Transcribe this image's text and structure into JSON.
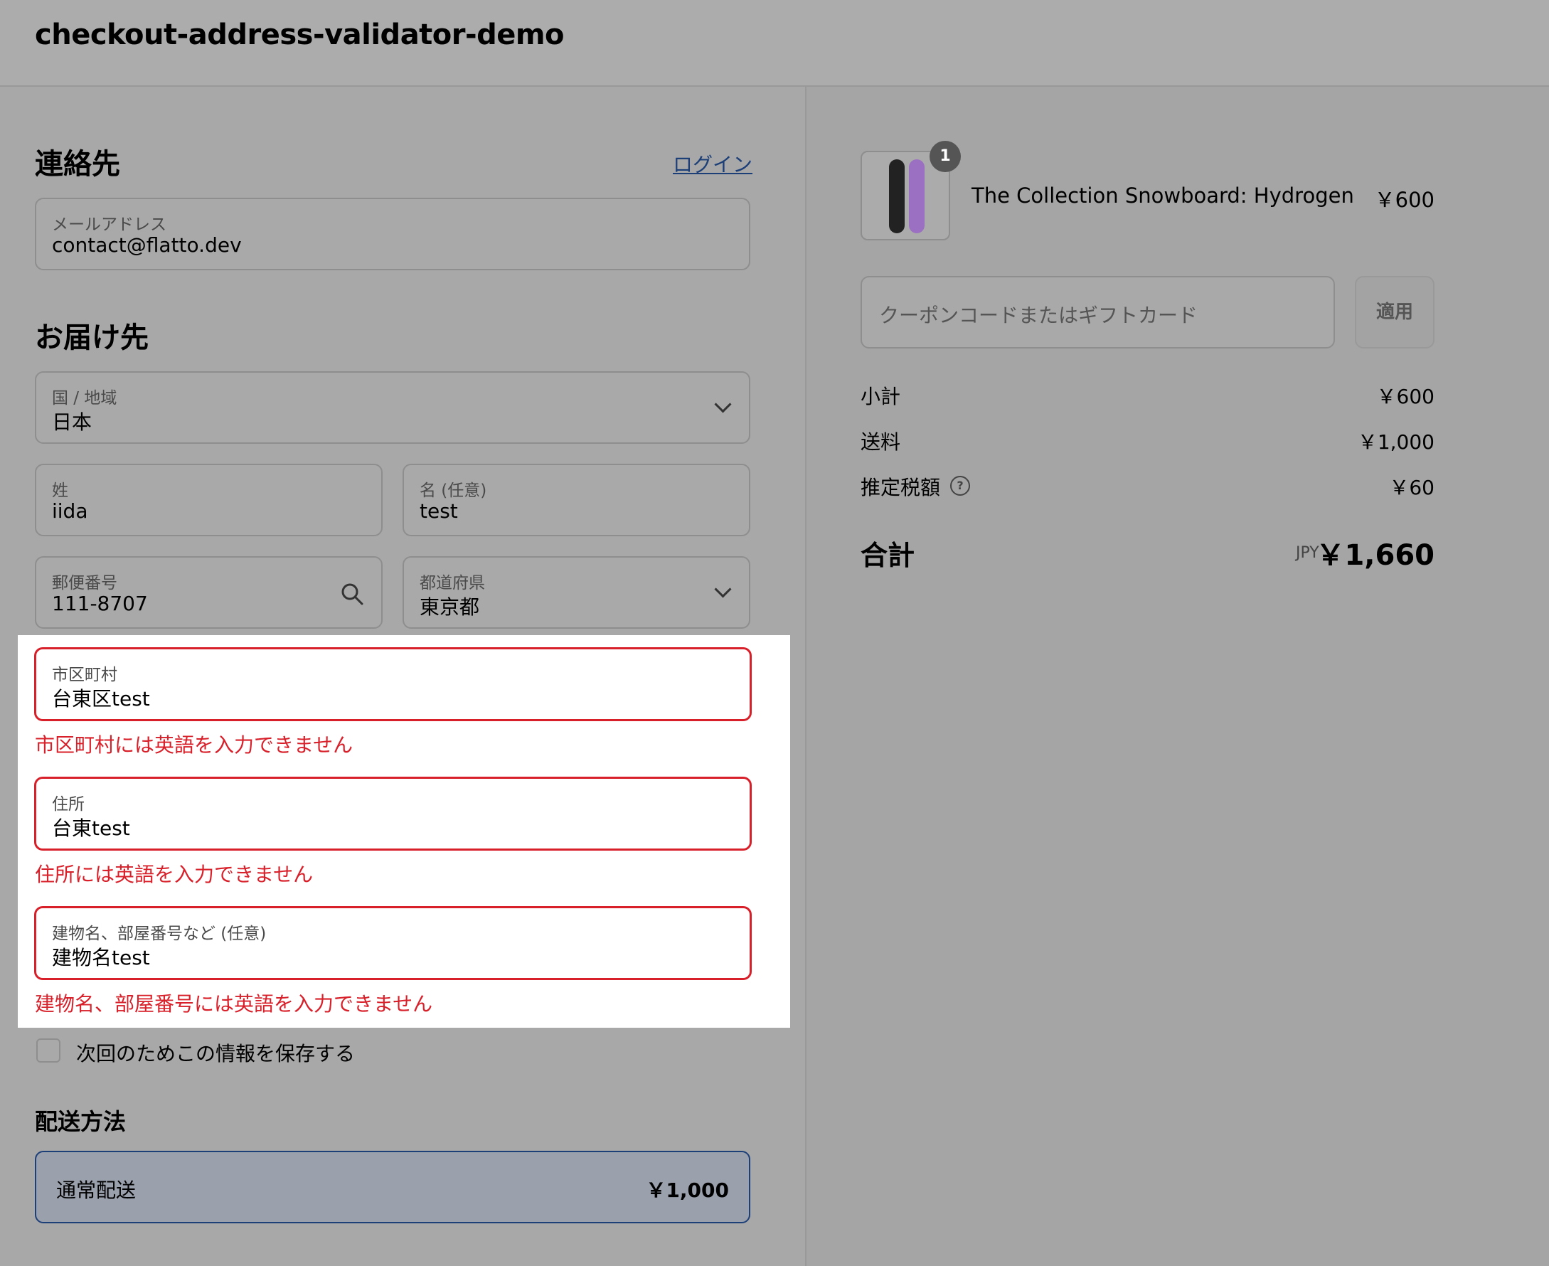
{
  "header": {
    "title": "checkout-address-validator-demo"
  },
  "contact": {
    "heading": "連絡先",
    "login_link": "ログイン",
    "email": {
      "label": "メールアドレス",
      "value": "contact@flatto.dev"
    }
  },
  "delivery": {
    "heading": "お届け先",
    "country": {
      "label": "国 / 地域",
      "value": "日本"
    },
    "last_name": {
      "label": "姓",
      "value": "iida"
    },
    "first_name": {
      "label": "名 (任意)",
      "value": "test"
    },
    "postal": {
      "label": "郵便番号",
      "value": "111-8707"
    },
    "prefecture": {
      "label": "都道府県",
      "value": "東京都"
    },
    "city": {
      "label": "市区町村",
      "value": "台東区test",
      "error": "市区町村には英語を入力できません"
    },
    "address": {
      "label": "住所",
      "value": "台東test",
      "error": "住所には英語を入力できません"
    },
    "building": {
      "label": "建物名、部屋番号など (任意)",
      "value": "建物名test",
      "error": "建物名、部屋番号には英語を入力できません"
    },
    "save_info": "次回のためこの情報を保存する"
  },
  "shipping": {
    "heading": "配送方法",
    "option": {
      "name": "通常配送",
      "price": "￥1,000"
    }
  },
  "summary": {
    "product": {
      "name": "The Collection Snowboard: Hydrogen",
      "price": "￥600",
      "quantity": "1"
    },
    "coupon": {
      "placeholder": "クーポンコードまたはギフトカード",
      "apply": "適用"
    },
    "subtotal": {
      "label": "小計",
      "value": "￥600"
    },
    "shipping": {
      "label": "送料",
      "value": "￥1,000"
    },
    "tax": {
      "label": "推定税額",
      "value": "￥60"
    },
    "total": {
      "label": "合計",
      "currency": "JPY",
      "value": "￥1,660"
    }
  },
  "colors": {
    "error": "#d8202a",
    "link": "#1d3f78"
  }
}
